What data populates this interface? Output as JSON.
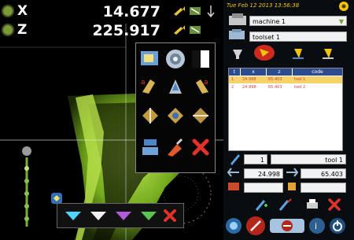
{
  "axes": {
    "x": {
      "label": "X",
      "value": "14.677"
    },
    "z": {
      "label": "Z",
      "value": "225.917"
    }
  },
  "status": {
    "datetime": "Tue Feb 12 2013 13:56:38"
  },
  "selectors": {
    "machine": {
      "value": "machine 1"
    },
    "toolset": {
      "value": "toolset 1"
    }
  },
  "table": {
    "columns": [
      "t",
      "x",
      "z",
      "code"
    ],
    "rows": [
      {
        "t": "1",
        "x": "24.998",
        "z": "65.403",
        "code": "tool 1"
      },
      {
        "t": "2",
        "x": "24.998",
        "z": "65.403",
        "code": "tool 2"
      }
    ]
  },
  "tool_form": {
    "number": "1",
    "name": "tool 1",
    "x_offset": "24.998",
    "z_offset": "65.403",
    "field_a": "",
    "field_b": ""
  },
  "colors": {
    "accent_yellow": "#f1c40f",
    "selected_row": "#f5d36a",
    "header_blue": "#2d4b8f",
    "camera_green": "#9ad43a",
    "close_red": "#e0322a"
  },
  "icons": {
    "popup": [
      "image-sub-icon",
      "lens-icon",
      "contrast-icon",
      "tool-left-icon",
      "tool-center-icon",
      "tool-right-icon",
      "measure-left-icon",
      "measure-center-icon",
      "measure-right-icon",
      "operator-icon",
      "probe-icon",
      "close-icon"
    ],
    "bottom_bar": [
      "cyan-gem-icon",
      "white-gem-icon",
      "purple-gem-icon",
      "green-gem-icon",
      "close-icon"
    ]
  }
}
